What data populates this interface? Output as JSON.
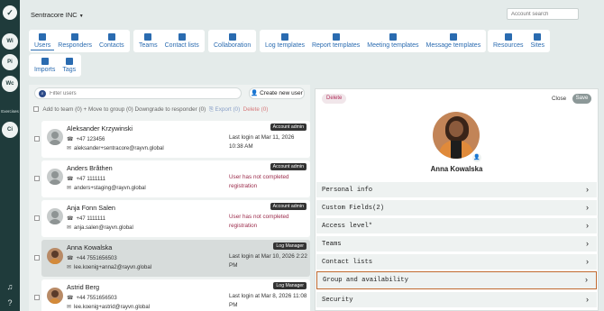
{
  "org": {
    "name": "Sentracore INC"
  },
  "account_search": {
    "placeholder": "Account search"
  },
  "rail": {
    "workspaces": [
      "Wi",
      "Pi",
      "Wc",
      "Ci"
    ],
    "exercises_label": "Exercises"
  },
  "tabs": {
    "group1": [
      "Users",
      "Responders",
      "Contacts"
    ],
    "group2": [
      "Teams",
      "Contact lists"
    ],
    "group3": [
      "Collaboration"
    ],
    "group4": [
      "Log templates",
      "Report templates",
      "Meeting templates",
      "Message templates"
    ],
    "group5": [
      "Resources",
      "Sites"
    ],
    "group6": [
      "Imports",
      "Tags"
    ]
  },
  "list": {
    "filter_placeholder": "Filter users",
    "create_label": "Create new user",
    "bulk": {
      "add_to_team": "Add to team (0)",
      "move_to_group": "Move to group (0)",
      "downgrade": "Downgrade to responder (0)",
      "export": "Export (0)",
      "delete": "Delete (0)"
    },
    "users": [
      {
        "name": "Aleksander Krzywinski",
        "phone": "+47 123456",
        "email": "aleksander+sentracore@rayvn.global",
        "badge": "Account admin",
        "status": "Last login at Mar 11, 2026 10:38 AM",
        "warn": false
      },
      {
        "name": "Anders Bråthen",
        "phone": "+47 1111111",
        "email": "anders+staging@rayvn.global",
        "badge": "Account admin",
        "status": "User has not completed registration",
        "warn": true
      },
      {
        "name": "Anja Fonn Salen",
        "phone": "+47 1111111",
        "email": "anja.salen@rayvn.global",
        "badge": "Account admin",
        "status": "User has not completed registration",
        "warn": true
      },
      {
        "name": "Anna Kowalska",
        "phone": "+44 7551656503",
        "email": "lee.koenig+anna2@rayvn.global",
        "badge": "Log Manager",
        "status": "Last login at Mar 10, 2026 2:22 PM",
        "warn": false
      },
      {
        "name": "Astrid Berg",
        "phone": "+44 7551656503",
        "email": "lee.koenig+astrid@rayvn.global",
        "badge": "Log Manager",
        "status": "Last login at Mar 8, 2026 11:08 PM",
        "warn": false
      }
    ]
  },
  "detail": {
    "delete_label": "Delete",
    "close_label": "Close",
    "save_label": "Save",
    "name": "Anna Kowalska",
    "sections": [
      "Personal info",
      "Custom Fields(2)",
      "Access level*",
      "Teams",
      "Contact lists",
      "Group and availability",
      "Security"
    ]
  }
}
